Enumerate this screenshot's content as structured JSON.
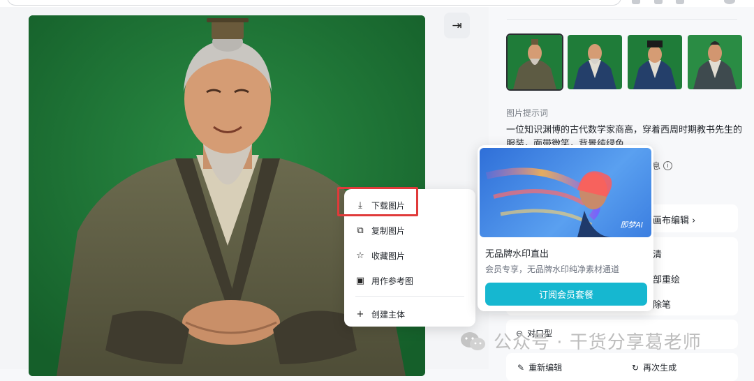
{
  "colors": {
    "accent": "#16b7d0",
    "highlight": "#e03a3a",
    "portrait_bg": "#1d7a37"
  },
  "panel": {
    "prompt_label": "图片提示词",
    "prompt_text": "一位知识渊博的古代数学家商高，穿着西周时期教书先生的服装，面带微笑，背景纯绿色",
    "info_fragment": "息",
    "canvas_edit_fragment": "画布编辑",
    "option_fragment_1": "清",
    "option_fragment_2": "部重绘",
    "option_fragment_3": "除笔",
    "lip_sync": "对口型",
    "re_edit": "重新编辑",
    "regenerate": "再次生成"
  },
  "context_menu": {
    "items": [
      {
        "label": "下载图片",
        "icon": "download-icon"
      },
      {
        "label": "复制图片",
        "icon": "copy-icon"
      },
      {
        "label": "收藏图片",
        "icon": "star-icon"
      },
      {
        "label": "用作参考图",
        "icon": "reference-image-icon"
      },
      {
        "label": "创建主体",
        "icon": "plus-icon"
      }
    ]
  },
  "promo": {
    "title": "无品牌水印直出",
    "subtitle": "会员专享，无品牌水印纯净素材通道",
    "button": "订阅会员套餐",
    "logo_text": "即梦AI"
  },
  "watermark": {
    "text": "公众号 · 干货分享葛老师"
  }
}
